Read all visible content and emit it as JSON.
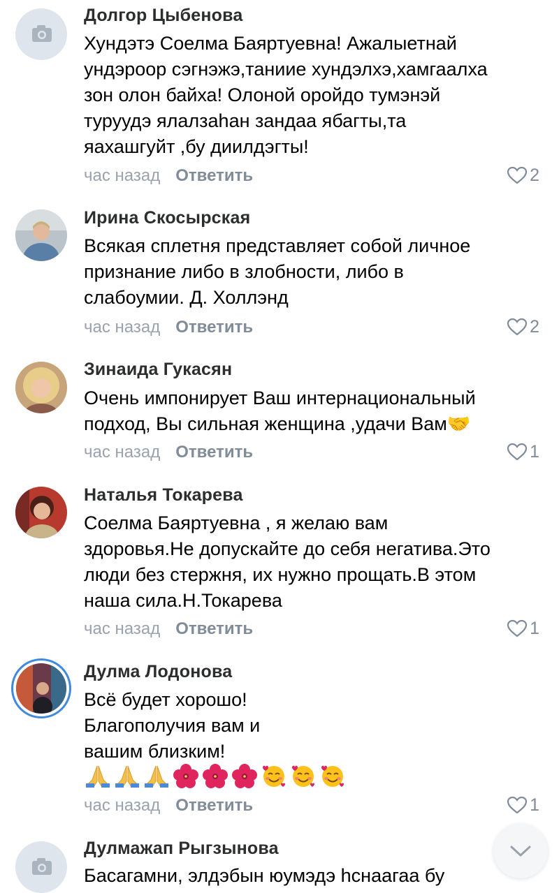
{
  "comments": [
    {
      "author": "Долгор Цыбенова",
      "avatar": "camera-placeholder",
      "text": "Хундэтэ Соелма Баяртуевна! Ажалыетнай\nундэроор сэгнэжэ,таниие хундэлхэ,хамгаалха\nзон олон байха! Олоной оройдо тумэнэй\nтуруудэ ялалзаhан зандаа ябагты,та\nяахашгуйт ,бу диилдэгты!",
      "time": "час назад",
      "reply": "Ответить",
      "likes": "2"
    },
    {
      "author": "Ирина Скосырская",
      "avatar": "photo",
      "text": "Всякая сплетня представляет собой личное\nпризнание либо в злобности, либо в\nслабоумии. Д. Холлэнд",
      "time": "час назад",
      "reply": "Ответить",
      "likes": "2"
    },
    {
      "author": "Зинаида Гукасян",
      "avatar": "photo",
      "text": "Очень импонирует Ваш интернациональный\nподход,  Вы сильная женщина ,удачи Вам🤝",
      "time": "час назад",
      "reply": "Ответить",
      "likes": "1"
    },
    {
      "author": "Наталья Токарева",
      "avatar": "photo",
      "text": "Соелма Баяртуевна , я желаю вам\nздоровья.Не допускайте до себя негатива.Это\nлюди без стержня, их нужно прощать.В этом\nнаша сила.Н.Токарева",
      "time": "час назад",
      "reply": "Ответить",
      "likes": "1"
    },
    {
      "author": "Дулма Лодонова",
      "avatar": "photo-story",
      "text": "Всё будет хорошо!\nБлагополучия вам и\nвашим близким!",
      "emojis": [
        "pray",
        "pray",
        "pray",
        "hibiscus",
        "hibiscus",
        "hibiscus",
        "smiling-face-hearts",
        "smiling-face-hearts",
        "smiling-face-hearts"
      ],
      "time": "час назад",
      "reply": "Ответить",
      "likes": "1"
    },
    {
      "author": "Дулмажап Рыгзынова",
      "avatar": "camera-placeholder",
      "text": "Басагамни, элдэбын юумэдэ hснаагаа бу"
    }
  ],
  "scroll_button": {
    "icon": "chevron-down-icon"
  },
  "colors": {
    "author": "#2c2d2e",
    "meta": "#99a2ad",
    "reply": "#818c99",
    "story_ring": "#3f8ae0",
    "placeholder_bg": "#dfe5ec"
  }
}
